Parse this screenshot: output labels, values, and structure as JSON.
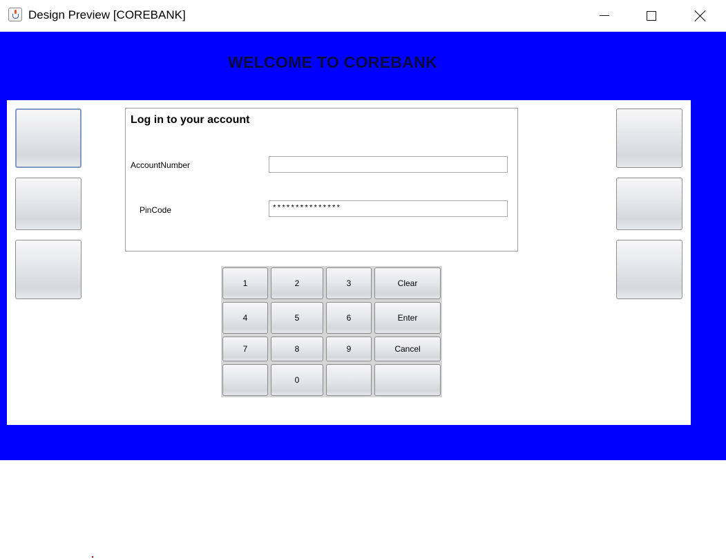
{
  "window": {
    "title": "Design Preview [COREBANK]",
    "icon": "java-cup-icon"
  },
  "header": {
    "welcome": "WELCOME TO COREBANK"
  },
  "login": {
    "title": "Log in to your account",
    "account_label": "AccountNumber",
    "account_value": "",
    "pin_label": "PinCode",
    "pin_value": "***************"
  },
  "keypad": {
    "keys": [
      "1",
      "2",
      "3",
      "Clear",
      "4",
      "5",
      "6",
      "Enter",
      "7",
      "8",
      "9",
      "Cancel",
      "",
      "0",
      "",
      ""
    ]
  },
  "colors": {
    "frame": "#0000ff",
    "panel": "#ffffff"
  }
}
